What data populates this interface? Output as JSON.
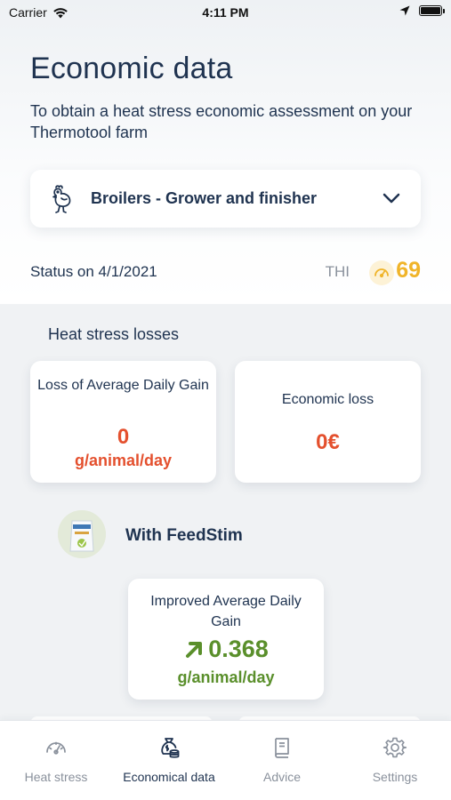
{
  "status_bar": {
    "carrier": "Carrier",
    "time": "4:11 PM"
  },
  "header": {
    "title": "Economic data",
    "subtitle": "To obtain a heat stress economic assessment on your Thermotool farm"
  },
  "selector": {
    "icon": "chicken-icon",
    "label": "Broilers - Grower and finisher"
  },
  "status": {
    "date_text": "Status on 4/1/2021",
    "thi_label": "THI",
    "thi_value": "69"
  },
  "losses": {
    "section_title": "Heat stress losses",
    "adg": {
      "title": "Loss of Average Daily Gain",
      "value": "0",
      "unit": "g/animal/day"
    },
    "economic": {
      "title": "Economic loss",
      "value": "0€"
    }
  },
  "product": {
    "name": "With FeedStim",
    "improved": {
      "title": "Improved Average Daily Gain",
      "value": "0.368",
      "unit": "g/animal/day"
    }
  },
  "tabs": [
    {
      "label": "Heat stress",
      "icon": "gauge-icon",
      "active": false
    },
    {
      "label": "Economical data",
      "icon": "money-bag-icon",
      "active": true
    },
    {
      "label": "Advice",
      "icon": "book-icon",
      "active": false
    },
    {
      "label": "Settings",
      "icon": "gear-icon",
      "active": false
    }
  ],
  "colors": {
    "primary_text": "#1f3350",
    "loss_red": "#e4502e",
    "gain_green": "#5a8f2b",
    "thi_yellow": "#f0b429",
    "muted": "#8a919c",
    "content_bg": "#f0f2f4"
  }
}
